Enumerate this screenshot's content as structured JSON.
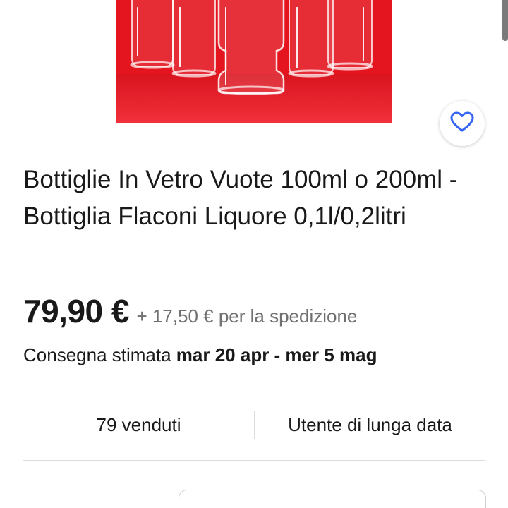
{
  "listing": {
    "title": "Bottiglie In Vetro Vuote 100ml o 200ml - Bottiglia Flaconi Liquore 0,1l/0,2litri",
    "price": "79,90 €",
    "shipping": "+ 17,50 € per la spedizione",
    "delivery_label": "Consegna stimata",
    "delivery_dates": "mar 20 apr - mer 5 mag",
    "sold": "79 venduti",
    "seller_badge": "Utente di lunga data"
  },
  "icons": {
    "watch": "heart-icon"
  },
  "colors": {
    "image_background": "#e8202a",
    "accent": "#3665f3",
    "text": "#191919",
    "secondary_text": "#707070"
  }
}
